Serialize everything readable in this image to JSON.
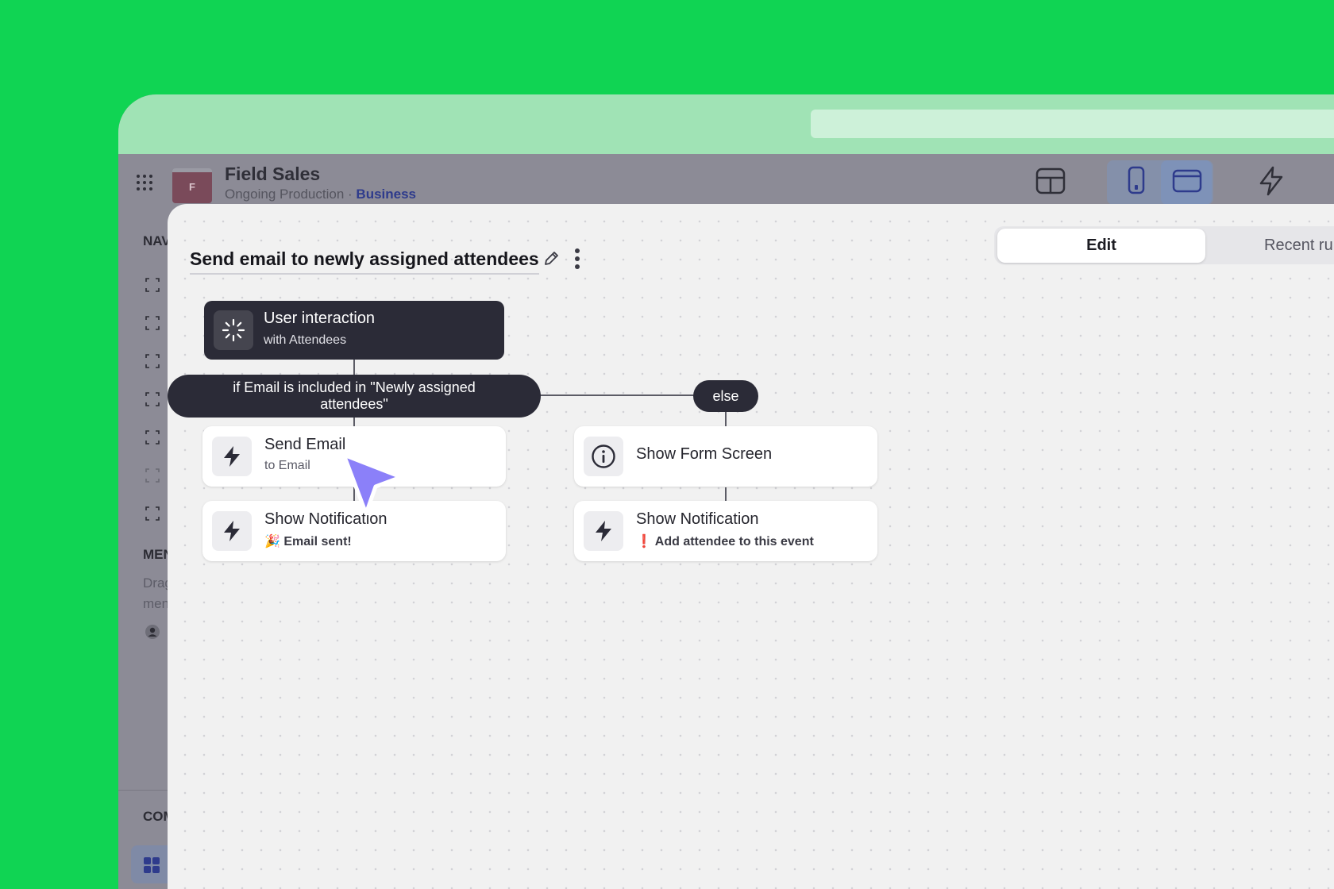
{
  "app": {
    "name": "Field Sales",
    "logo_letter": "F",
    "subtitle": "Ongoing Production",
    "separator": "·",
    "tier": "Business"
  },
  "sidebar": {
    "nav_label": "NAV",
    "menu_label": "MEN",
    "menu_hint_line1": "Drag",
    "menu_hint_line2": "men",
    "components_label": "COM"
  },
  "flow": {
    "title": "Send email to newly assigned attendees",
    "tabs": {
      "edit": "Edit",
      "recent": "Recent ru"
    },
    "trigger": {
      "title": "User interaction",
      "subtitle": "with Attendees"
    },
    "condition": {
      "line1": "if Email is included in \"Newly assigned",
      "line2": "attendees\""
    },
    "else_label": "else",
    "left_branch": [
      {
        "title": "Send Email",
        "subtitle": "to Email"
      },
      {
        "title": "Show Notification",
        "emoji": "🎉",
        "subtitle": "Email sent!"
      }
    ],
    "right_branch": [
      {
        "title": "Show Form Screen"
      },
      {
        "title": "Show Notification",
        "emoji": "❗",
        "subtitle": "Add attendee to this event"
      }
    ]
  },
  "colors": {
    "background": "#10d453",
    "node_dark": "#2b2b37",
    "cursor": "#8b80f9"
  }
}
